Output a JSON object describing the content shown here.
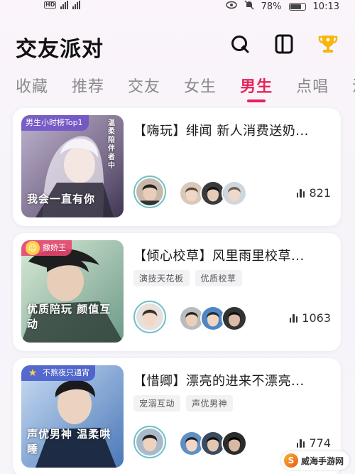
{
  "status_bar": {
    "network_label": "HD",
    "battery": "78%",
    "time": "10:13",
    "icons": [
      "signal-icon",
      "eye-icon",
      "mute-bell-icon",
      "battery-icon"
    ]
  },
  "header": {
    "title": "交友派对",
    "icons": [
      "search-icon",
      "sidebar-toggle-icon",
      "trophy-icon"
    ]
  },
  "tabs": [
    {
      "label": "收藏",
      "active": false
    },
    {
      "label": "推荐",
      "active": false
    },
    {
      "label": "交友",
      "active": false
    },
    {
      "label": "女生",
      "active": false
    },
    {
      "label": "男生",
      "active": true
    },
    {
      "label": "点唱",
      "active": false
    },
    {
      "label": "派",
      "active": false
    }
  ],
  "accent_color": "#e5245a",
  "rooms": [
    {
      "badge": "男生小时榜Top1",
      "cover_caption": "我会一直有你",
      "cover_side_text": "温柔陪伴者中",
      "title": "【嗨玩】绯闻 新人消费送奶...",
      "tags": [],
      "viewers": "821"
    },
    {
      "badge": "撒娇王",
      "cover_caption": "优质陪玩 颜值互动",
      "cover_side_text": "",
      "title": "【倾心校草】风里雨里校草...",
      "tags": [
        "演技天花板",
        "优质校草"
      ],
      "viewers": "1063"
    },
    {
      "badge": "不熬夜只通宵",
      "cover_caption": "声优男神 温柔哄睡",
      "cover_side_text": "",
      "title": "【惜卿】漂亮的进来不漂亮...",
      "tags": [
        "宠溺互动",
        "声优男神"
      ],
      "viewers": "774"
    }
  ],
  "watermark": "威海手游网"
}
